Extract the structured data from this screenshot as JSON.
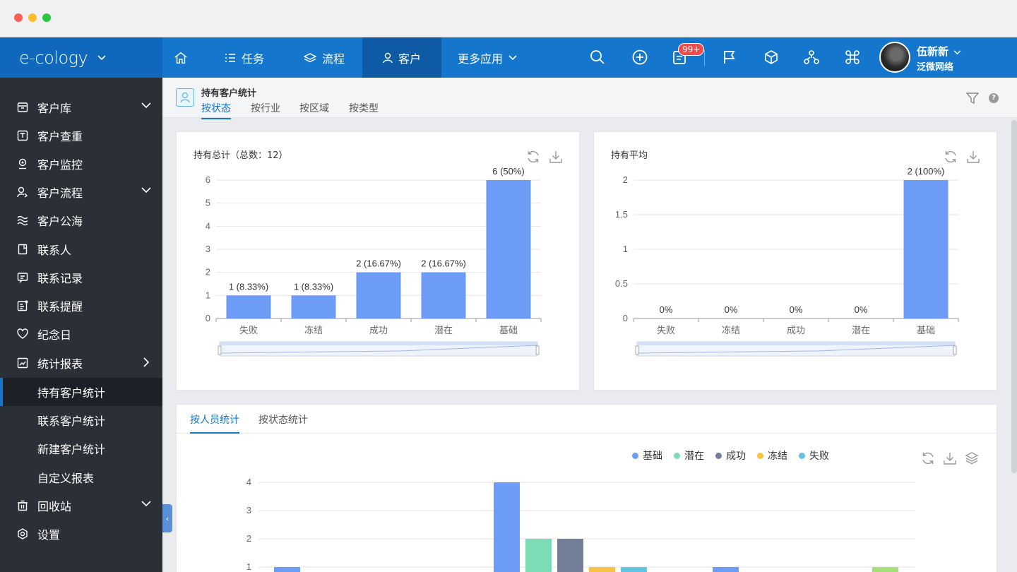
{
  "brand": {
    "name": "e-cology"
  },
  "nav": {
    "items": [
      {
        "label": "任务"
      },
      {
        "label": "流程"
      },
      {
        "label": "客户"
      },
      {
        "label": "更多应用"
      }
    ],
    "badge": "99+",
    "user": {
      "name": "伍新新",
      "org": "泛微网络"
    }
  },
  "sidebar": {
    "items": [
      {
        "label": "客户库"
      },
      {
        "label": "客户查重"
      },
      {
        "label": "客户监控"
      },
      {
        "label": "客户流程"
      },
      {
        "label": "客户公海"
      },
      {
        "label": "联系人"
      },
      {
        "label": "联系记录"
      },
      {
        "label": "联系提醒"
      },
      {
        "label": "纪念日"
      },
      {
        "label": "统计报表"
      },
      {
        "label": "持有客户统计"
      },
      {
        "label": "联系客户统计"
      },
      {
        "label": "新建客户统计"
      },
      {
        "label": "自定义报表"
      },
      {
        "label": "回收站"
      },
      {
        "label": "设置"
      }
    ]
  },
  "page": {
    "title": "持有客户统计",
    "tabs": [
      "按状态",
      "按行业",
      "按区域",
      "按类型"
    ]
  },
  "colors": {
    "bar": "#6d9cf6",
    "nav": "#1476cc",
    "sidebar": "#2b2f36"
  },
  "chart_data": [
    {
      "type": "bar",
      "title": "持有总计（总数：12）",
      "categories": [
        "失败",
        "冻结",
        "成功",
        "潜在",
        "基础"
      ],
      "values": [
        1,
        1,
        2,
        2,
        6
      ],
      "labels": [
        "1 (8.33%)",
        "1 (8.33%)",
        "2 (16.67%)",
        "2 (16.67%)",
        "6 (50%)"
      ],
      "yticks": [
        "0",
        "1",
        "2",
        "3",
        "4",
        "5",
        "6"
      ],
      "ylim": [
        0,
        6
      ]
    },
    {
      "type": "bar",
      "title": "持有平均",
      "categories": [
        "失败",
        "冻结",
        "成功",
        "潜在",
        "基础"
      ],
      "values": [
        0,
        0,
        0,
        0,
        2
      ],
      "labels": [
        "0%",
        "0%",
        "0%",
        "0%",
        "2 (100%)"
      ],
      "yticks": [
        "0",
        "0.5",
        "1",
        "1.5",
        "2"
      ],
      "ylim": [
        0,
        2
      ]
    },
    {
      "type": "bar",
      "tabs": [
        "按人员统计",
        "按状态统计"
      ],
      "legend": [
        "基础",
        "潜在",
        "成功",
        "冻结",
        "失败"
      ],
      "legend_colors": [
        "#6d9cf6",
        "#7bdcb5",
        "#748099",
        "#f6c344",
        "#5ec4e0"
      ],
      "yticks": [
        "1",
        "2",
        "3",
        "4"
      ],
      "series": [
        {
          "name": "基础",
          "values": [
            1,
            4,
            1
          ]
        },
        {
          "name": "潜在",
          "values": [
            0,
            2,
            0
          ]
        },
        {
          "name": "成功",
          "values": [
            0,
            2,
            0
          ]
        },
        {
          "name": "冻结",
          "values": [
            0,
            1,
            0
          ]
        },
        {
          "name": "失败",
          "values": [
            0,
            1,
            0
          ]
        }
      ],
      "extra_value": 1,
      "extra_color": "#a3e07a"
    }
  ]
}
